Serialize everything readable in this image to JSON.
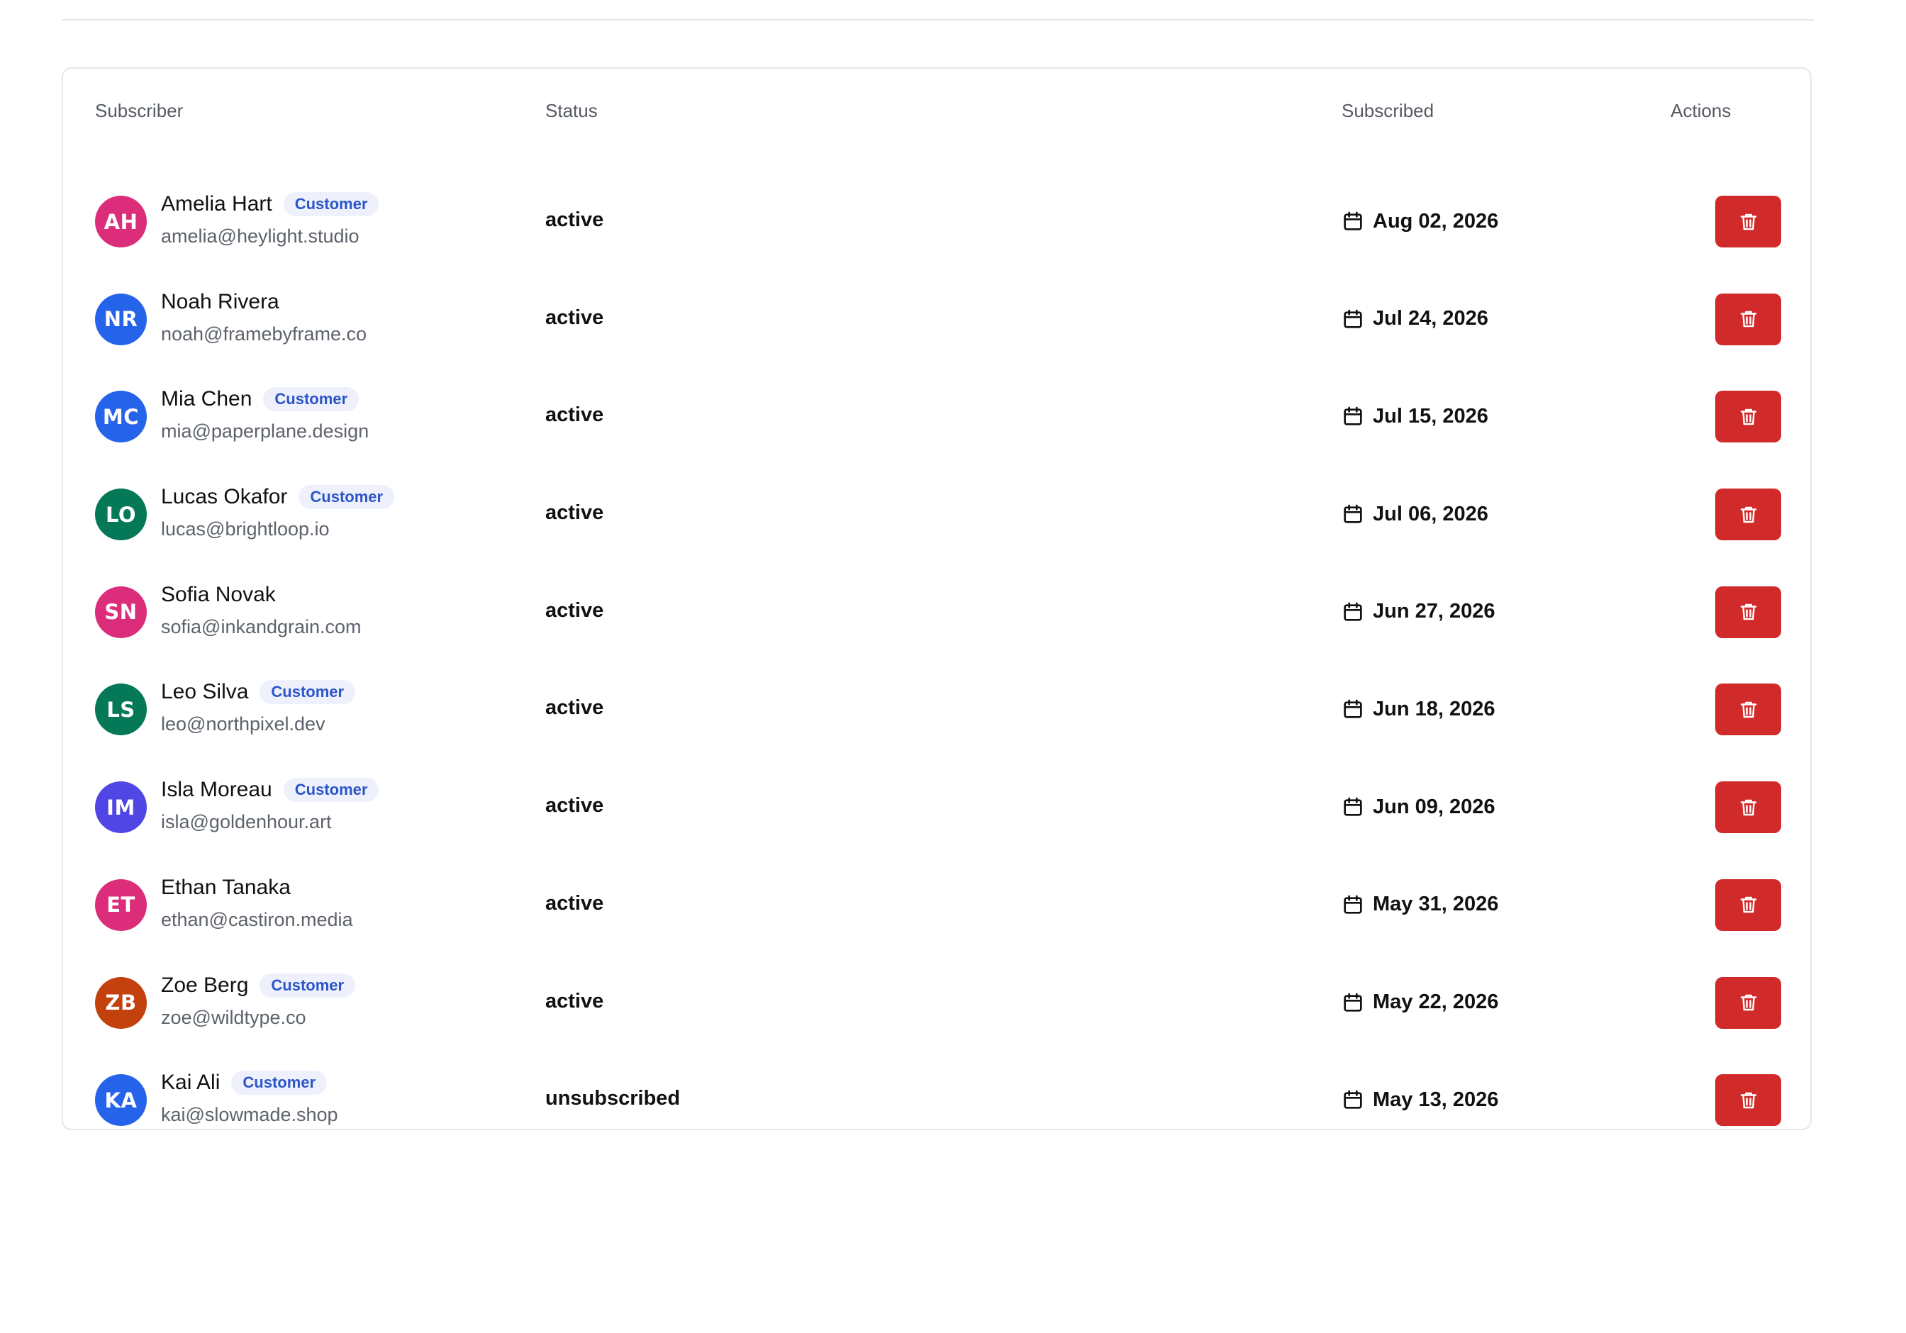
{
  "table": {
    "headers": {
      "subscriber": "Subscriber",
      "status": "Status",
      "subscribed": "Subscribed",
      "actions": "Actions"
    },
    "rows": [
      {
        "initials": "AH",
        "name": "Amelia Hart",
        "badge": "Customer",
        "email": "amelia@heylight.studio",
        "status": "active",
        "date": "Aug 02, 2026",
        "avatar_color": "#dc2d7b"
      },
      {
        "initials": "NR",
        "name": "Noah Rivera",
        "badge": "",
        "email": "noah@framebyframe.co",
        "status": "active",
        "date": "Jul 24, 2026",
        "avatar_color": "#2563eb"
      },
      {
        "initials": "MC",
        "name": "Mia Chen",
        "badge": "Customer",
        "email": "mia@paperplane.design",
        "status": "active",
        "date": "Jul 15, 2026",
        "avatar_color": "#2563eb"
      },
      {
        "initials": "LO",
        "name": "Lucas Okafor",
        "badge": "Customer",
        "email": "lucas@brightloop.io",
        "status": "active",
        "date": "Jul 06, 2026",
        "avatar_color": "#047857"
      },
      {
        "initials": "SN",
        "name": "Sofia Novak",
        "badge": "",
        "email": "sofia@inkandgrain.com",
        "status": "active",
        "date": "Jun 27, 2026",
        "avatar_color": "#dc2d7b"
      },
      {
        "initials": "LS",
        "name": "Leo Silva",
        "badge": "Customer",
        "email": "leo@northpixel.dev",
        "status": "active",
        "date": "Jun 18, 2026",
        "avatar_color": "#047857"
      },
      {
        "initials": "IM",
        "name": "Isla Moreau",
        "badge": "Customer",
        "email": "isla@goldenhour.art",
        "status": "active",
        "date": "Jun 09, 2026",
        "avatar_color": "#4f46e5"
      },
      {
        "initials": "ET",
        "name": "Ethan Tanaka",
        "badge": "",
        "email": "ethan@castiron.media",
        "status": "active",
        "date": "May 31, 2026",
        "avatar_color": "#dc2d7b"
      },
      {
        "initials": "ZB",
        "name": "Zoe Berg",
        "badge": "Customer",
        "email": "zoe@wildtype.co",
        "status": "active",
        "date": "May 22, 2026",
        "avatar_color": "#c2410c"
      },
      {
        "initials": "KA",
        "name": "Kai Ali",
        "badge": "Customer",
        "email": "kai@slowmade.shop",
        "status": "unsubscribed",
        "date": "May 13, 2026",
        "avatar_color": "#2563eb"
      }
    ]
  },
  "icons": {
    "date": "calendar-icon",
    "delete": "trash-icon"
  },
  "colors": {
    "delete_button": "#d12a2a",
    "badge_background": "#eef1fb",
    "badge_text": "#2b55c9"
  }
}
